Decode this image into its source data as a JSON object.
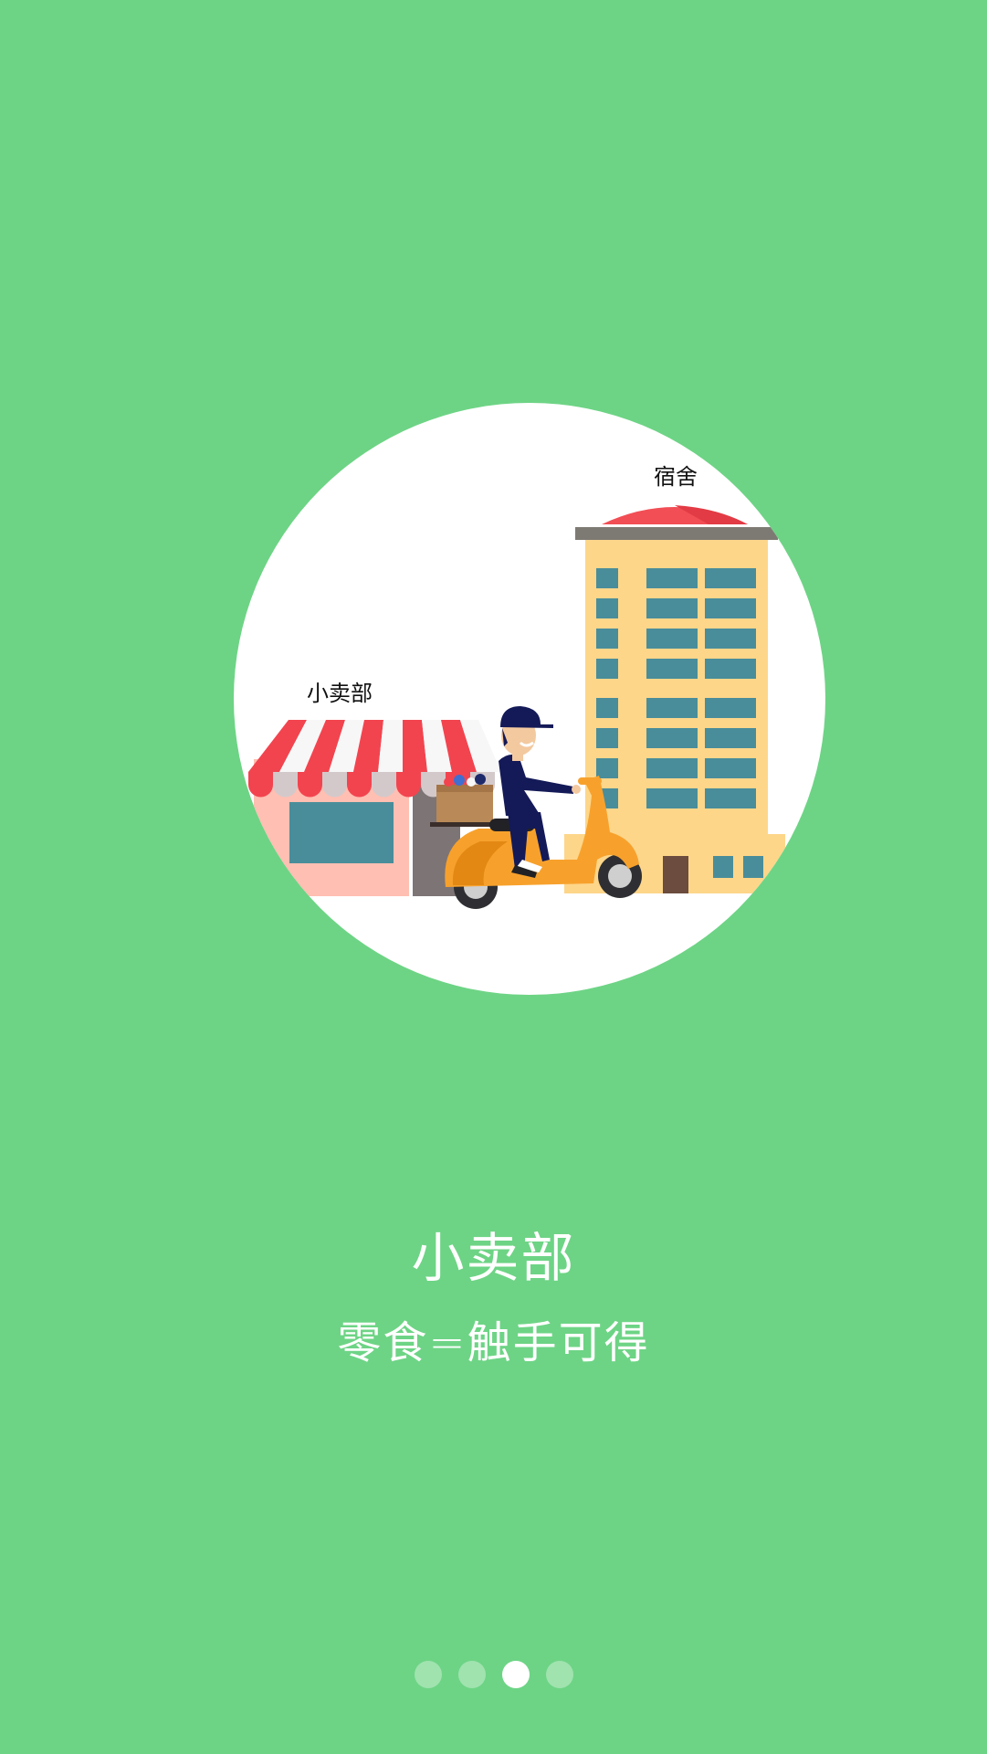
{
  "illustration": {
    "store_label": "小卖部",
    "dorm_label": "宿舍"
  },
  "headline": "小卖部",
  "tagline": "零食=触手可得",
  "pager": {
    "count": 4,
    "active_index": 2
  },
  "colors": {
    "background": "#6dd485",
    "awning_red": "#f2444f",
    "building_yellow": "#fdd68a",
    "window_teal": "#498d9a",
    "scooter_orange": "#f7a12c",
    "rider_navy": "#141a57"
  }
}
